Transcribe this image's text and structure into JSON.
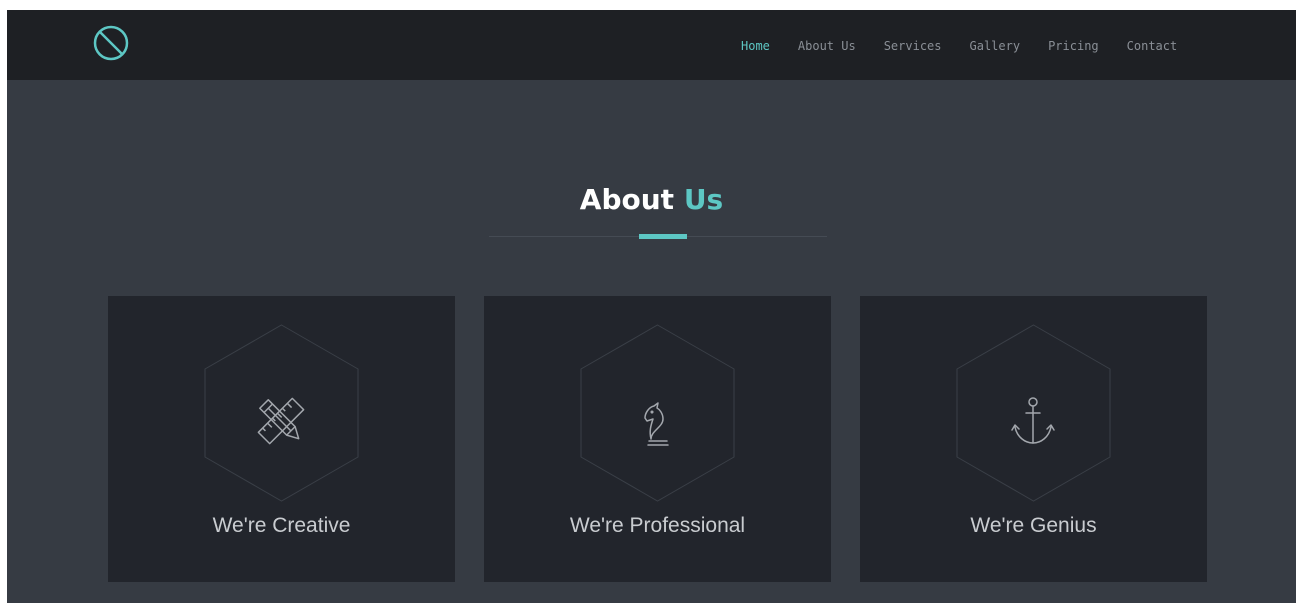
{
  "colors": {
    "accent": "#5dc7c4",
    "navbar_bg": "#1e2024",
    "page_bg": "#363b43",
    "card_bg": "#22252c",
    "nav_text": "#8a8f96",
    "title_text": "#ffffff"
  },
  "navbar": {
    "logo_icon": "circle-slash-logo-icon",
    "items": [
      {
        "label": "Home",
        "active": true
      },
      {
        "label": "About Us",
        "active": false
      },
      {
        "label": "Services",
        "active": false
      },
      {
        "label": "Gallery",
        "active": false
      },
      {
        "label": "Pricing",
        "active": false
      },
      {
        "label": "Contact",
        "active": false
      }
    ]
  },
  "section": {
    "title_main": "About",
    "title_accent": "Us"
  },
  "cards": [
    {
      "label": "We're Creative",
      "icon": "pencil-ruler-icon"
    },
    {
      "label": "We're Professional",
      "icon": "chess-knight-icon"
    },
    {
      "label": "We're Genius",
      "icon": "anchor-icon"
    }
  ]
}
